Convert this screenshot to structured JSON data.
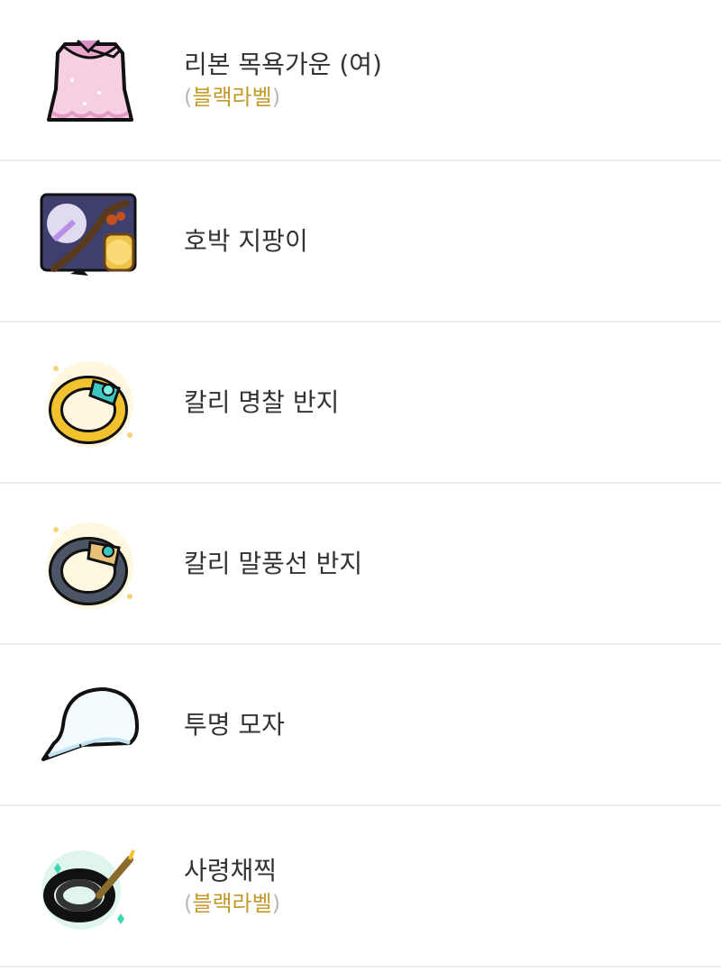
{
  "colors": {
    "text": "#333333",
    "divider": "#ececec",
    "label": "#c29a2b",
    "paren": "#b8b8b8"
  },
  "items": [
    {
      "name": "리본 목욕가운 (여)",
      "icon": "pink-bathrobe-icon",
      "label_open": "(",
      "label": "블랙라벨",
      "label_close": ")"
    },
    {
      "name": "호박 지팡이",
      "icon": "pumpkin-staff-icon"
    },
    {
      "name": "칼리 명찰 반지",
      "icon": "gold-ring-icon"
    },
    {
      "name": "칼리 말풍선 반지",
      "icon": "dark-ring-icon"
    },
    {
      "name": "투명 모자",
      "icon": "transparent-cap-icon"
    },
    {
      "name": "사령채찍",
      "icon": "whip-icon",
      "label_open": "(",
      "label": "블랙라벨",
      "label_close": ")"
    }
  ]
}
